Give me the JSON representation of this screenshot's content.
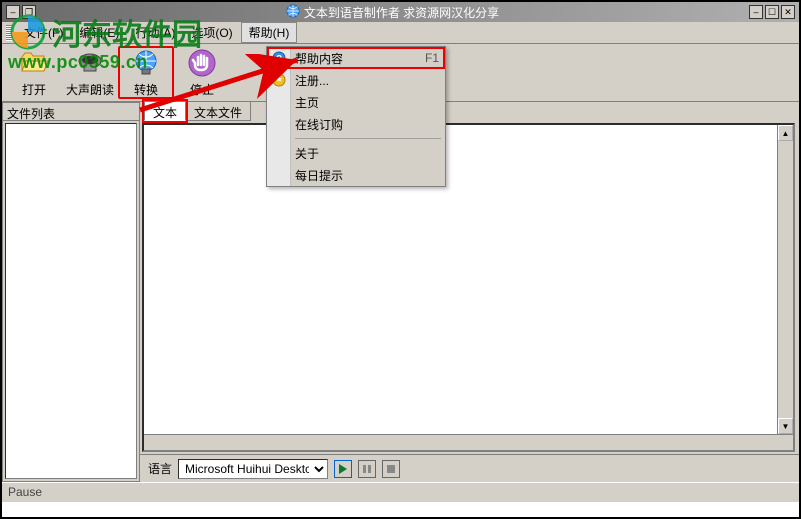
{
  "title": "文本到语音制作者 求资源网汉化分享",
  "menus": {
    "file": "文件(F)",
    "edit": "编辑(E)",
    "action": "行动(A)",
    "options": "选项(O)",
    "help": "帮助(H)"
  },
  "toolbar": {
    "open": "打开",
    "read_aloud": "大声朗读",
    "convert": "转换",
    "stop": "停止"
  },
  "sidebar": {
    "header": "文件列表"
  },
  "tabs": {
    "text": "文本",
    "text_file": "文本文件"
  },
  "help_menu": {
    "help_content": "帮助内容",
    "help_shortcut": "F1",
    "register": "注册...",
    "homepage": "主页",
    "order_online": "在线订购",
    "about": "关于",
    "daily_tip": "每日提示"
  },
  "bottom": {
    "lang_label": "语言",
    "lang_value": "Microsoft Huihui Desktc"
  },
  "status": {
    "text": "Pause"
  },
  "watermark": {
    "brand": "河东软件园",
    "url": "www.pc0359.cn"
  },
  "colors": {
    "highlight": "#e00000",
    "wm_green": "#018a01"
  }
}
